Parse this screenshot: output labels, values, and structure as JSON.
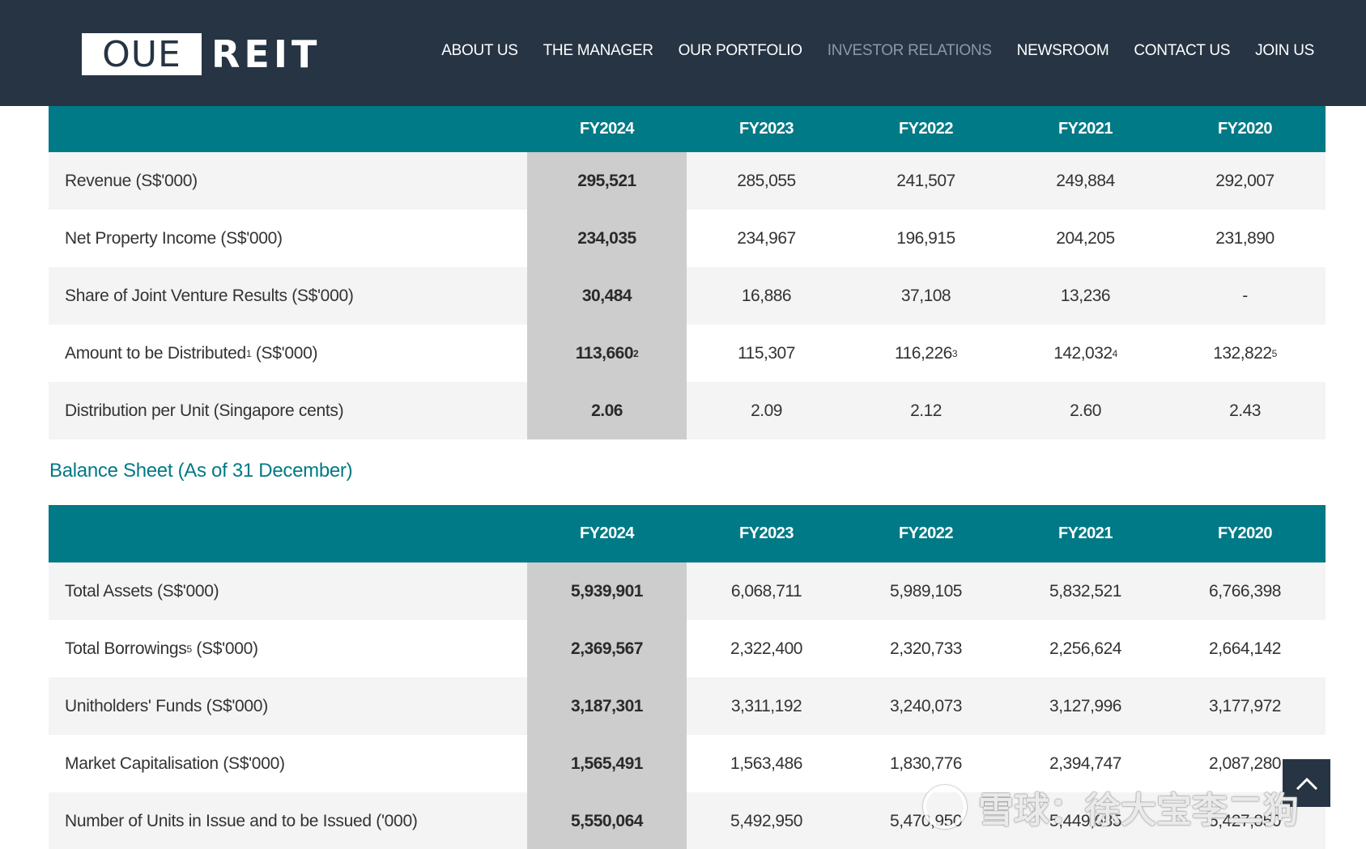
{
  "header": {
    "logo_box": "OUE",
    "logo_text": "REIT",
    "nav": [
      {
        "label": "ABOUT US",
        "active": false
      },
      {
        "label": "THE MANAGER",
        "active": false
      },
      {
        "label": "OUR PORTFOLIO",
        "active": false
      },
      {
        "label": "INVESTOR RELATIONS",
        "active": true
      },
      {
        "label": "NEWSROOM",
        "active": false
      },
      {
        "label": "CONTACT US",
        "active": false
      },
      {
        "label": "JOIN US",
        "active": false
      }
    ]
  },
  "income_table": {
    "columns": [
      "FY2024",
      "FY2023",
      "FY2022",
      "FY2021",
      "FY2020"
    ],
    "rows": [
      {
        "label": "Revenue (S$'000)",
        "values": [
          "295,521",
          "285,055",
          "241,507",
          "249,884",
          "292,007"
        ]
      },
      {
        "label": "Net Property Income (S$'000)",
        "values": [
          "234,035",
          "234,967",
          "196,915",
          "204,205",
          "231,890"
        ]
      },
      {
        "label": "Share of Joint Venture Results (S$'000)",
        "values": [
          "30,484",
          "16,886",
          "37,108",
          "13,236",
          "-"
        ]
      },
      {
        "label": "Amount to be Distributed",
        "label_sup": "1",
        "label_suffix": " (S$'000)",
        "values": [
          "113,660",
          "115,307",
          "116,226",
          "142,032",
          "132,822"
        ],
        "sups": [
          "2",
          "",
          "3",
          "4",
          "5"
        ]
      },
      {
        "label": "Distribution per Unit (Singapore cents)",
        "values": [
          "2.06",
          "2.09",
          "2.12",
          "2.60",
          "2.43"
        ]
      }
    ]
  },
  "balance_section_title": "Balance Sheet (As of 31 December)",
  "balance_table": {
    "columns": [
      "FY2024",
      "FY2023",
      "FY2022",
      "FY2021",
      "FY2020"
    ],
    "rows": [
      {
        "label": "Total Assets (S$'000)",
        "values": [
          "5,939,901",
          "6,068,711",
          "5,989,105",
          "5,832,521",
          "6,766,398"
        ]
      },
      {
        "label": "Total Borrowings",
        "label_sup": "5",
        "label_suffix": " (S$'000)",
        "values": [
          "2,369,567",
          "2,322,400",
          "2,320,733",
          "2,256,624",
          "2,664,142"
        ]
      },
      {
        "label": "Unitholders' Funds (S$'000)",
        "values": [
          "3,187,301",
          "3,311,192",
          "3,240,073",
          "3,127,996",
          "3,177,972"
        ]
      },
      {
        "label": "Market Capitalisation (S$'000)",
        "values": [
          "1,565,491",
          "1,563,486",
          "1,830,776",
          "2,394,747",
          "2,087,280"
        ]
      },
      {
        "label": "Number of Units in Issue and to be Issued ('000)",
        "values": [
          "5,550,064",
          "5,492,950",
          "5,470,950",
          "5,449,685",
          "5,427,850"
        ]
      }
    ]
  },
  "watermark": "雪球：徐大宝李二狗",
  "scroll_top_icon": "chevron-up-icon",
  "colors": {
    "header_bg": "#263444",
    "teal": "#007a86",
    "highlight": "#cdcdcd",
    "row_alt": "#f4f4f4"
  }
}
